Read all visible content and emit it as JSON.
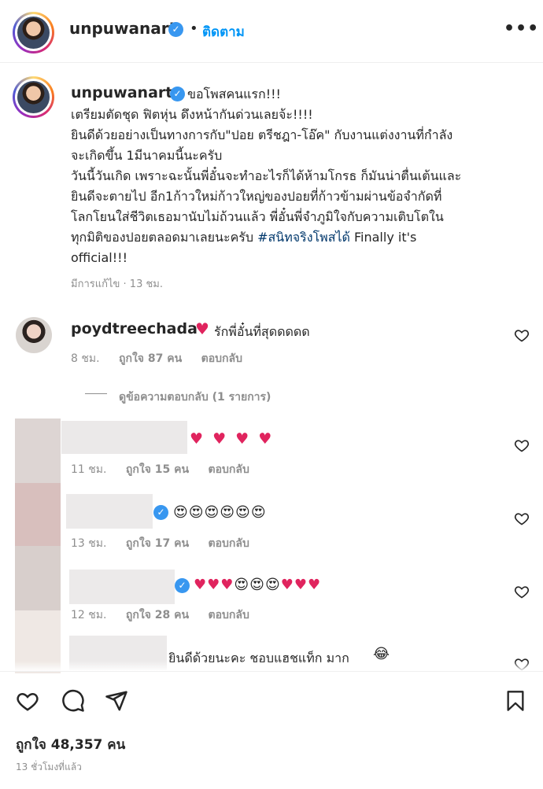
{
  "header": {
    "username": "unpuwanart",
    "separator": "•",
    "follow_label": "ติดตาม",
    "more_label": "•••"
  },
  "caption": {
    "username": "unpuwanart",
    "first_line": "ขอโพสคนแรก!!!",
    "lines": [
      "เตรียมตัดชุด ฟิตหุ่น ดึงหน้ากันด่วนเลยจ้ะ!!!!",
      "ยินดีด้วยอย่างเป็นทางการกับ\"ปอย ตรีชฎา-โอ๊ค\" กับงานแต่งงานที่กำลัง",
      "จะเกิดขึ้น 1มีนาคมนี้นะครับ",
      "วันนี้วันเกิด เพราะฉะนั้นพี่อั๋นจะทำอะไรก็ได้ห้ามโกรธ ก็มันน่าตื่นเต้นและ",
      "ยินดีจะตายไป อีก1ก้าวใหม่ก้าวใหญ่ของปอยที่ก้าวข้ามผ่านข้อจำกัดที่",
      "โลกโยนใส่ชีวิตเธอมานับไม่ถ้วนแล้ว พี่อั๋นพี่จำภูมิใจกับความเติบโตใน"
    ],
    "line_last_prefix": "ทุกมิติของปอยตลอดมาเลยนะครับ ",
    "hashtag": "#สนิทจริงโพสได้",
    "line_last_suffix": " Finally it's",
    "line_end": "official!!!",
    "meta": "มีการแก้ไข · 13 ชม."
  },
  "comments": [
    {
      "username": "poydtreechada",
      "text": "รักพี่อั๋นที่สุดดดดด",
      "emoji": "♥",
      "time": "8 ชม.",
      "likes": "ถูกใจ 87 คน",
      "reply": "ตอบกลับ"
    },
    {
      "username": "",
      "emoji": "♥ ♥ ♥ ♥",
      "time": "11 ชม.",
      "likes": "ถูกใจ 15 คน",
      "reply": "ตอบกลับ"
    },
    {
      "username": "",
      "emoji": "😍😍😍😍😍😍",
      "time": "13 ชม.",
      "likes": "ถูกใจ 17 คน",
      "reply": "ตอบกลับ"
    },
    {
      "username": "",
      "emoji_hearts_a": "♥♥♥",
      "emoji_faces": "😍😍😍",
      "emoji_hearts_b": "♥♥♥",
      "time": "12 ชม.",
      "likes": "ถูกใจ 28 คน",
      "reply": "ตอบกลับ"
    },
    {
      "username": "",
      "text": "ยินดีด้วยนะคะ ชอบแฮชแท็ก มาก",
      "emoji": "😂"
    }
  ],
  "view_replies": "ดูข้อความตอบกลับ (1 รายการ)",
  "footer": {
    "likes": "ถูกใจ 48,357 คน",
    "time_ago": "13 ชั่วโมงที่แล้ว"
  },
  "colors": {
    "accent": "#0095f6",
    "verified": "#3897f0",
    "heart": "#e0245e",
    "muted": "#8e8e8e"
  },
  "icons": [
    "verified-badge-icon",
    "more-options-icon",
    "heart-outline-icon",
    "comment-icon",
    "share-icon",
    "bookmark-icon"
  ]
}
